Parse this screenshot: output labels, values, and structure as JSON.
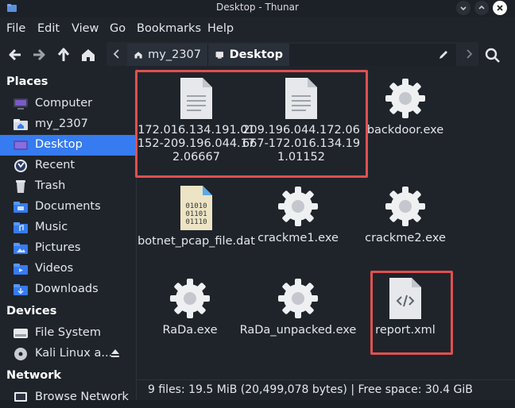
{
  "window": {
    "title": "Desktop - Thunar"
  },
  "menubar": [
    "File",
    "Edit",
    "View",
    "Go",
    "Bookmarks",
    "Help"
  ],
  "toolbar": {
    "back_icon": "arrow-left-icon",
    "forward_icon": "arrow-right-icon",
    "up_icon": "arrow-up-icon",
    "home_icon": "home-icon"
  },
  "pathbar": {
    "crumbs": [
      {
        "label": "my_2307",
        "icon": "home-icon"
      },
      {
        "label": "Desktop",
        "icon": "desktop-icon",
        "active": true
      }
    ]
  },
  "sidebar": {
    "places_header": "Places",
    "places": [
      {
        "label": "Computer",
        "icon": "computer-icon"
      },
      {
        "label": "my_2307",
        "icon": "home-folder-icon"
      },
      {
        "label": "Desktop",
        "icon": "desktop-icon",
        "selected": true
      },
      {
        "label": "Recent",
        "icon": "recent-icon"
      },
      {
        "label": "Trash",
        "icon": "trash-icon"
      },
      {
        "label": "Documents",
        "icon": "documents-folder-icon"
      },
      {
        "label": "Music",
        "icon": "music-folder-icon"
      },
      {
        "label": "Pictures",
        "icon": "pictures-folder-icon"
      },
      {
        "label": "Videos",
        "icon": "videos-folder-icon"
      },
      {
        "label": "Downloads",
        "icon": "downloads-folder-icon"
      }
    ],
    "devices_header": "Devices",
    "devices": [
      {
        "label": "File System",
        "icon": "drive-icon"
      },
      {
        "label": "Kali Linux a...",
        "icon": "optical-disc-icon"
      }
    ],
    "network_header": "Network",
    "network": [
      {
        "label": "Browse Network",
        "icon": "network-icon"
      }
    ]
  },
  "files": [
    {
      "name": "172.016.134.191.01152-209.196.044.172.06667",
      "icon": "text-document-icon"
    },
    {
      "name": "209.196.044.172.06667-172.016.134.191.01152",
      "icon": "text-document-icon"
    },
    {
      "name": "backdoor.exe",
      "icon": "executable-gear-icon"
    },
    {
      "name": "botnet_pcap_file.dat",
      "icon": "binary-file-icon"
    },
    {
      "name": "crackme1.exe",
      "icon": "executable-gear-icon"
    },
    {
      "name": "crackme2.exe",
      "icon": "executable-gear-icon"
    },
    {
      "name": "RaDa.exe",
      "icon": "executable-gear-icon"
    },
    {
      "name": "RaDa_unpacked.exe",
      "icon": "executable-gear-icon"
    },
    {
      "name": "report.xml",
      "icon": "xml-file-icon"
    }
  ],
  "statusbar": {
    "text": "9 files: 19.5 MiB (20,499,078 bytes)  |  Free space: 30.4 GiB"
  },
  "colors": {
    "selection": "#367bf0",
    "highlight_box": "#e0504f",
    "background": "#1f242b"
  }
}
